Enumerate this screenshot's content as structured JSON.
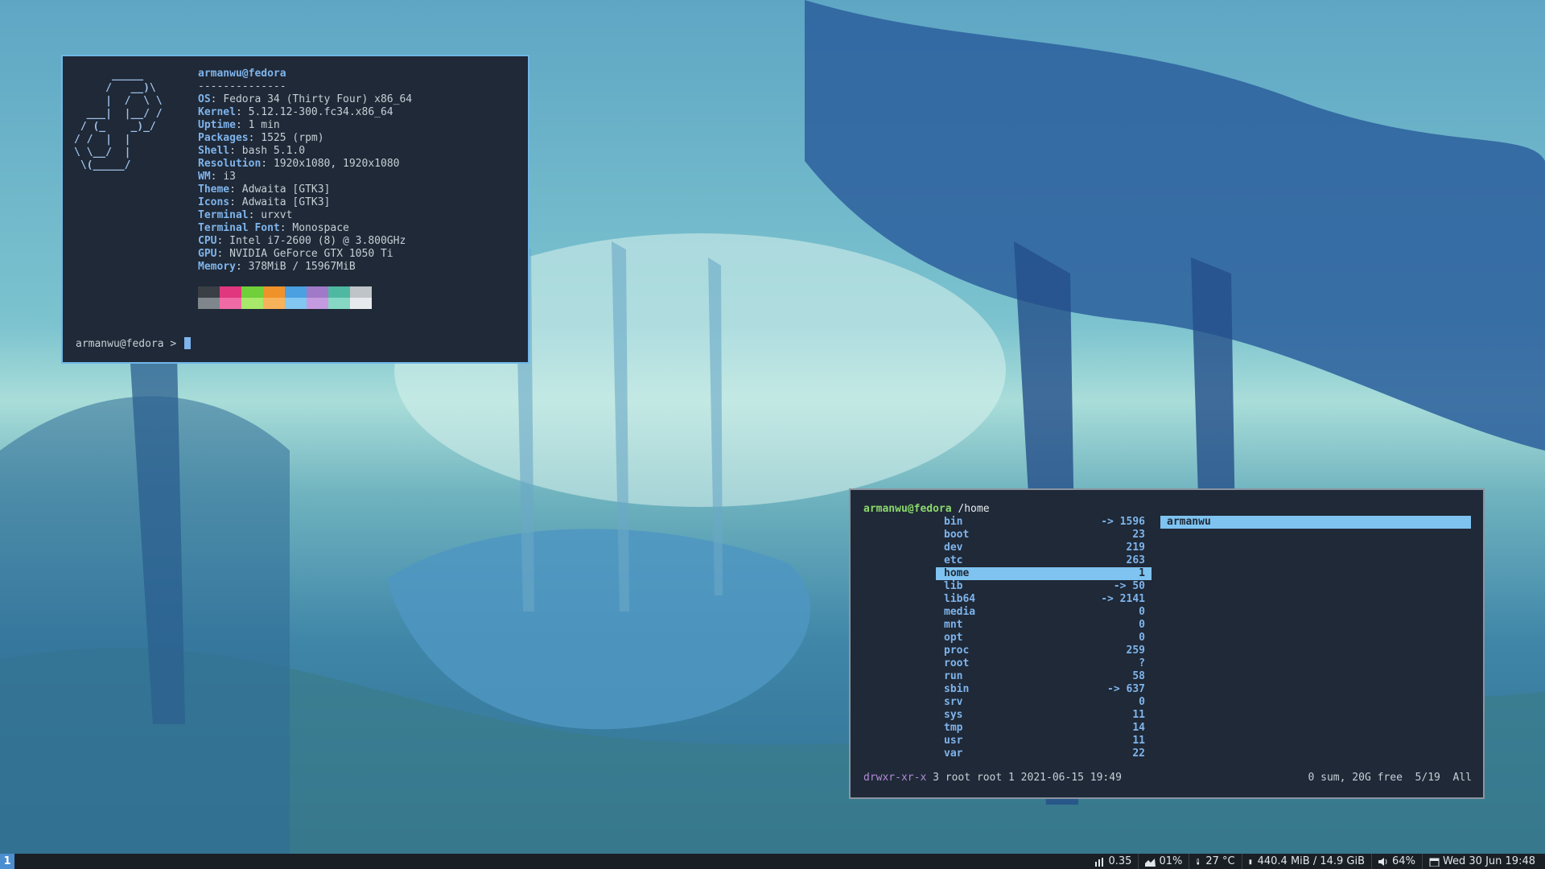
{
  "neofetch": {
    "ascii": "      _____\n     /   __)\\\n     |  /  \\ \\\n  ___|  |__/ /\n / (_    _)_/\n/ /  |  |\n\\ \\__/  |\n \\(_____/",
    "user_host": "armanwu@fedora",
    "separator": "--------------",
    "rows": [
      {
        "key": "OS",
        "value": "Fedora 34 (Thirty Four) x86_64"
      },
      {
        "key": "Kernel",
        "value": "5.12.12-300.fc34.x86_64"
      },
      {
        "key": "Uptime",
        "value": "1 min"
      },
      {
        "key": "Packages",
        "value": "1525 (rpm)"
      },
      {
        "key": "Shell",
        "value": "bash 5.1.0"
      },
      {
        "key": "Resolution",
        "value": "1920x1080, 1920x1080"
      },
      {
        "key": "WM",
        "value": "i3"
      },
      {
        "key": "Theme",
        "value": "Adwaita [GTK3]"
      },
      {
        "key": "Icons",
        "value": "Adwaita [GTK3]"
      },
      {
        "key": "Terminal",
        "value": "urxvt"
      },
      {
        "key": "Terminal Font",
        "value": "Monospace"
      },
      {
        "key": "CPU",
        "value": "Intel i7-2600 (8) @ 3.800GHz"
      },
      {
        "key": "GPU",
        "value": "NVIDIA GeForce GTX 1050 Ti"
      },
      {
        "key": "Memory",
        "value": "378MiB / 15967MiB"
      }
    ],
    "palette_top": [
      "#3a3f46",
      "#e0377f",
      "#6fd03a",
      "#f0922a",
      "#4aa0e0",
      "#a07ac8",
      "#4fb8a0",
      "#bfc4c8"
    ],
    "palette_bottom": [
      "#7f868c",
      "#f06aa5",
      "#a8e86a",
      "#f7b25a",
      "#82c6f2",
      "#c49ae0",
      "#86d8c4",
      "#e8ebee"
    ],
    "prompt": "armanwu@fedora > "
  },
  "ranger": {
    "user_host": "armanwu@fedora",
    "path": "/home",
    "entries": [
      {
        "name": "bin",
        "count": "-> 1596"
      },
      {
        "name": "boot",
        "count": "23"
      },
      {
        "name": "dev",
        "count": "219"
      },
      {
        "name": "etc",
        "count": "263"
      },
      {
        "name": "home",
        "count": "1",
        "selected": true
      },
      {
        "name": "lib",
        "count": "-> 50"
      },
      {
        "name": "lib64",
        "count": "-> 2141"
      },
      {
        "name": "media",
        "count": "0"
      },
      {
        "name": "mnt",
        "count": "0"
      },
      {
        "name": "opt",
        "count": "0"
      },
      {
        "name": "proc",
        "count": "259"
      },
      {
        "name": "root",
        "count": "?"
      },
      {
        "name": "run",
        "count": "58"
      },
      {
        "name": "sbin",
        "count": "-> 637"
      },
      {
        "name": "srv",
        "count": "0"
      },
      {
        "name": "sys",
        "count": "11"
      },
      {
        "name": "tmp",
        "count": "14"
      },
      {
        "name": "usr",
        "count": "11"
      },
      {
        "name": "var",
        "count": "22"
      }
    ],
    "preview_item": "armanwu",
    "status_perm": "drwxr-xr-x",
    "status_meta": " 3 root root 1 2021-06-15 19:49",
    "status_right": "0 sum, 20G free  5/19  All"
  },
  "bar": {
    "workspace": "1",
    "load": "0.35",
    "cpu": "01%",
    "temp": "27 °C",
    "memory": "440.4 MiB / 14.9 GiB",
    "volume": "64%",
    "datetime": "Wed 30 Jun 19:48",
    "icons": [
      "chart-icon",
      "area-chart-icon",
      "thermometer-icon",
      "battery-icon",
      "speaker-icon",
      "calendar-icon"
    ]
  }
}
